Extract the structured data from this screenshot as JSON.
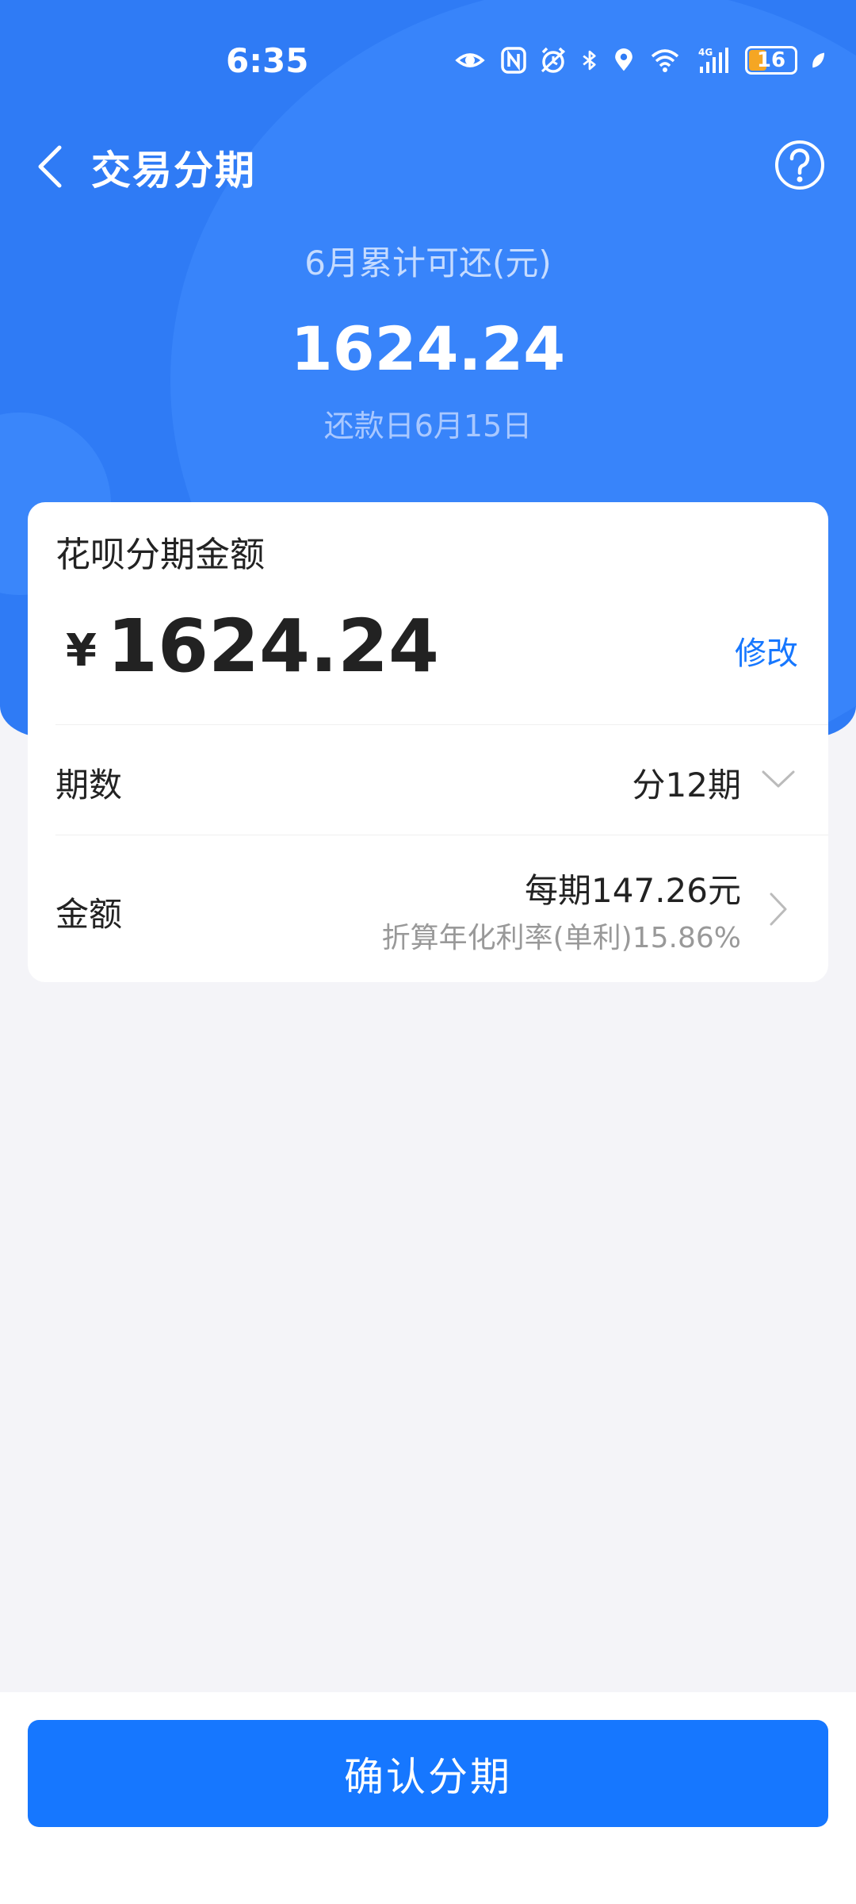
{
  "status_bar": {
    "time": "6:35",
    "battery": "16",
    "network": "4G",
    "icons": [
      "eye-icon",
      "nfc-icon",
      "alarm-icon",
      "bluetooth-icon",
      "location-icon",
      "wifi-icon",
      "signal-icon",
      "battery-icon",
      "leaf-icon"
    ]
  },
  "nav": {
    "title": "交易分期"
  },
  "summary": {
    "label": "6月累计可还(元)",
    "amount": "1624.24",
    "due_date": "还款日6月15日"
  },
  "card": {
    "title": "花呗分期金额",
    "currency": "¥",
    "amount": "1624.24",
    "edit_label": "修改",
    "periods_label": "期数",
    "periods_value": "分12期",
    "amount_label": "金额",
    "per_period": "每期147.26元",
    "rate_note": "折算年化利率(单利)15.86%"
  },
  "footer": {
    "confirm_label": "确认分期"
  },
  "colors": {
    "brand_blue": "#2f7bf5",
    "button_blue": "#1677ff",
    "background": "#f4f4f8"
  }
}
